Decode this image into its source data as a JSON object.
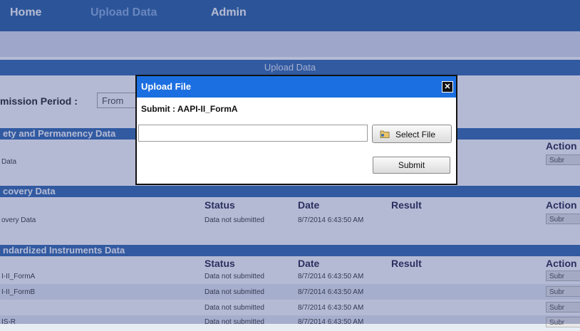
{
  "nav": {
    "items": [
      "Home",
      "Upload Data",
      "Admin"
    ]
  },
  "page": {
    "title": "Upload Data",
    "period_label": "mission Period :",
    "period_from": "From"
  },
  "sections": [
    {
      "title": "ety and Permanency Data",
      "columns": {
        "action": "Action"
      },
      "rows": [
        {
          "name": "Data",
          "action": "Subr"
        }
      ]
    },
    {
      "title": "covery Data",
      "columns": {
        "status": "Status",
        "date": "Date",
        "result": "Result",
        "action": "Action"
      },
      "rows": [
        {
          "name": "overy Data",
          "status": "Data not submitted",
          "date": "8/7/2014 6:43:50 AM",
          "action": "Subr"
        }
      ]
    },
    {
      "title": "ndardized Instruments Data",
      "columns": {
        "status": "Status",
        "date": "Date",
        "result": "Result",
        "action": "Action"
      },
      "rows": [
        {
          "name": "I-II_FormA",
          "status": "Data not submitted",
          "date": "8/7/2014 6:43:50 AM",
          "action": "Subr"
        },
        {
          "name": "I-II_FormB",
          "status": "Data not submitted",
          "date": "8/7/2014 6:43:50 AM",
          "action": "Subr"
        },
        {
          "name": "",
          "status": "Data not submitted",
          "date": "8/7/2014 6:43:50 AM",
          "action": "Subr"
        },
        {
          "name": "IS-R",
          "status": "Data not submitted",
          "date": "8/7/2014 6:43:50 AM",
          "action": "Subr"
        }
      ]
    }
  ],
  "dialog": {
    "title": "Upload File",
    "close_glyph": "✕",
    "subtitle": "Submit : AAPI-II_FormA",
    "file_input_value": "",
    "select_file_label": "Select File",
    "select_file_icon": "folder-icon",
    "submit_label": "Submit"
  },
  "colors": {
    "nav_bg": "#356aa8",
    "section_bg": "#3d72b4",
    "dialog_title_bg": "#1c6fe0",
    "overlay": "rgba(25,40,120,0.32)"
  }
}
